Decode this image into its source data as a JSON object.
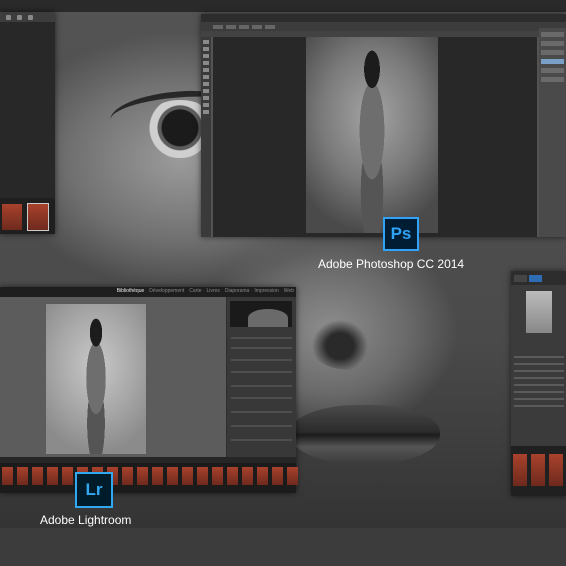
{
  "photoshop": {
    "caption": "Adobe Photoshop CC 2014",
    "logo_text": "Ps"
  },
  "lightroom": {
    "caption": "Adobe Lightroom",
    "logo_text": "Lr",
    "modules": [
      "Bibliothèque",
      "Développement",
      "Carte",
      "Livres",
      "Diaporama",
      "Impression",
      "Web"
    ]
  },
  "colors": {
    "ps_accent": "#2fa3f7",
    "lr_accent": "#31a8f0",
    "bridge_tab_active": "#2e6db4"
  }
}
